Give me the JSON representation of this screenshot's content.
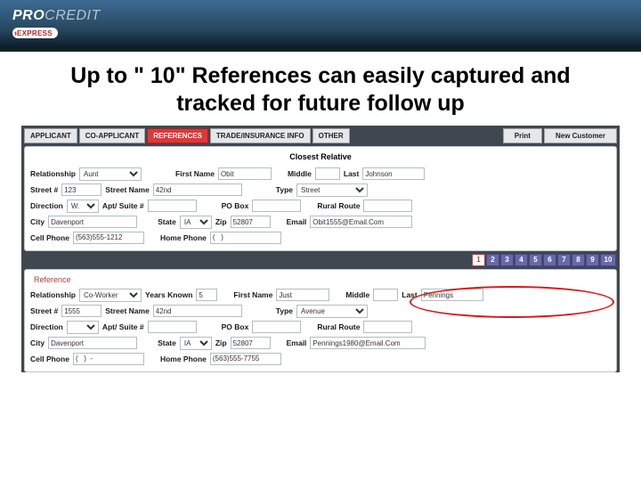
{
  "brand": {
    "pro": "PRO",
    "credit": "CREDIT",
    "express": "EXPRESS"
  },
  "title": "Up to \" 10\" References can easily captured and tracked for future follow up",
  "tabs": {
    "applicant": "APPLICANT",
    "co": "CO-APPLICANT",
    "ref": "REFERENCES",
    "trade": "TRADE/INSURANCE INFO",
    "other": "OTHER",
    "print": "Print",
    "newcust": "New Customer"
  },
  "relative": {
    "title": "Closest Relative",
    "labels": {
      "rel": "Relationship",
      "fn": "First Name",
      "mid": "Middle",
      "last": "Last",
      "streetno": "Street #",
      "streetnm": "Street Name",
      "type": "Type",
      "dir": "Direction",
      "apt": "Apt/ Suite #",
      "pobox": "PO Box",
      "rural": "Rural Route",
      "city": "City",
      "state": "State",
      "zip": "Zip",
      "email": "Email",
      "cell": "Cell Phone",
      "home": "Home Phone"
    },
    "vals": {
      "rel": "Aunt",
      "fn": "Obit",
      "mid": "",
      "last": "Johnson",
      "streetno": "123",
      "streetnm": "42nd",
      "type": "Street",
      "dir": "W.",
      "apt": "",
      "pobox": "",
      "rural": "",
      "city": "Davenport",
      "state": "IA",
      "zip": "52807",
      "email": "Obit1555@Email.Com",
      "cell": "(563)555-1212",
      "home": "(   )"
    }
  },
  "pager": [
    "1",
    "2",
    "3",
    "4",
    "5",
    "6",
    "7",
    "8",
    "9",
    "10"
  ],
  "reference": {
    "title": "Reference",
    "labels": {
      "rel": "Relationship",
      "years": "Years Known",
      "fn": "First Name",
      "mid": "Middle",
      "last": "Last",
      "streetno": "Street #",
      "streetnm": "Street Name",
      "type": "Type",
      "dir": "Direction",
      "apt": "Apt/ Suite #",
      "pobox": "PO Box",
      "rural": "Rural Route",
      "city": "City",
      "state": "State",
      "zip": "Zip",
      "email": "Email",
      "cell": "Cell Phone",
      "home": "Home Phone"
    },
    "vals": {
      "rel": "Co-Worker",
      "years": "5",
      "fn": "Just",
      "mid": "",
      "last": "Pennings",
      "streetno": "1555",
      "streetnm": "42nd",
      "type": "Avenue",
      "dir": "",
      "apt": "",
      "pobox": "",
      "rural": "",
      "city": "Davenport",
      "state": "IA",
      "zip": "52807",
      "email": "Pennings1980@Email.Com",
      "cell": "(   )  -",
      "home": "(563)555-7755"
    }
  }
}
